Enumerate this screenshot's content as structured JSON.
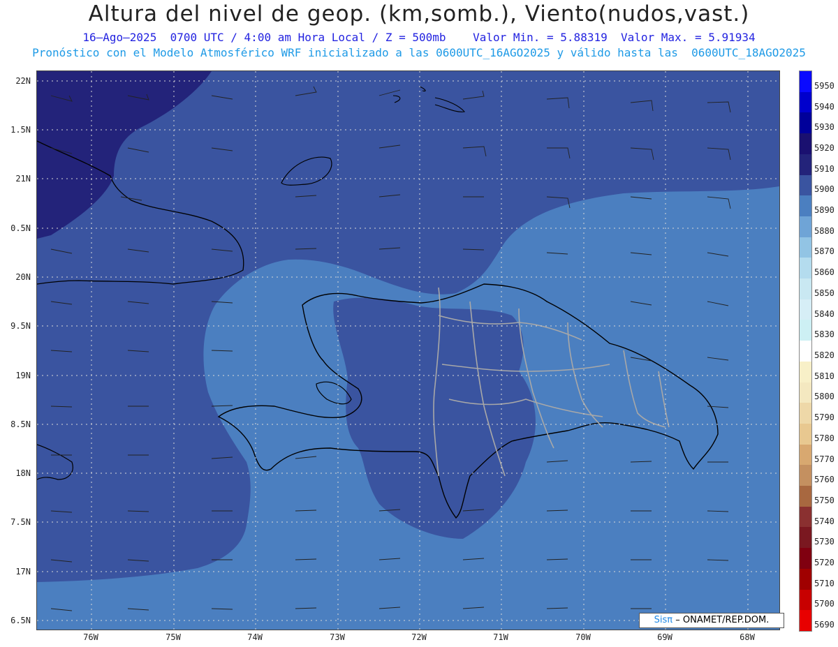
{
  "header": {
    "title": "Altura del nivel de geop. (km,somb.), Viento(nudos,vast.)",
    "subtitle": "16–Ago–2025  0700 UTC / 4:00 am Hora Local / Z = 500mb    Valor Min. = 5.88319  Valor Max. = 5.91934",
    "model_line": "Pronóstico con el Modelo Atmosférico WRF inicializado a las 0600UTC_16AGO2025 y válido hasta las  0600UTC_18AGO2025"
  },
  "map": {
    "lat_labels": [
      "22N",
      "1.5N",
      "21N",
      "0.5N",
      "20N",
      "9.5N",
      "19N",
      "8.5N",
      "18N",
      "7.5N",
      "17N",
      "6.5N"
    ],
    "lon_labels": [
      "76W",
      "75W",
      "74W",
      "73W",
      "72W",
      "71W",
      "70W",
      "69W",
      "68W"
    ],
    "fill_colors": {
      "z5910": "#23237a",
      "z5900": "#3a54a0",
      "z5890": "#4b7fc0",
      "land_border": "#000000",
      "province_border": "#a8a8a8"
    }
  },
  "colorbar": {
    "levels": [
      "5950",
      "5940",
      "5930",
      "5920",
      "5910",
      "5900",
      "5890",
      "5880",
      "5870",
      "5860",
      "5850",
      "5840",
      "5830",
      "5820",
      "5810",
      "5800",
      "5790",
      "5780",
      "5770",
      "5760",
      "5750",
      "5740",
      "5730",
      "5720",
      "5710",
      "5700",
      "5690"
    ],
    "colors": [
      "#0a0aff",
      "#0000cc",
      "#00009a",
      "#1a1070",
      "#23237a",
      "#3a54a0",
      "#4b7fc0",
      "#6fa4d6",
      "#92c4e4",
      "#b4dcee",
      "#c9e8f2",
      "#d6eef6",
      "#cdf0f4",
      "#ffffff",
      "#f8f0c8",
      "#f4e8c0",
      "#eed8a8",
      "#e8c890",
      "#d8a870",
      "#c49060",
      "#a86840",
      "#8a3030",
      "#7a1820",
      "#800010",
      "#a00000",
      "#c80000",
      "#e80000"
    ]
  },
  "credit": {
    "logo": "Sisπ",
    "text": "– ONAMET/REP.DOM."
  }
}
